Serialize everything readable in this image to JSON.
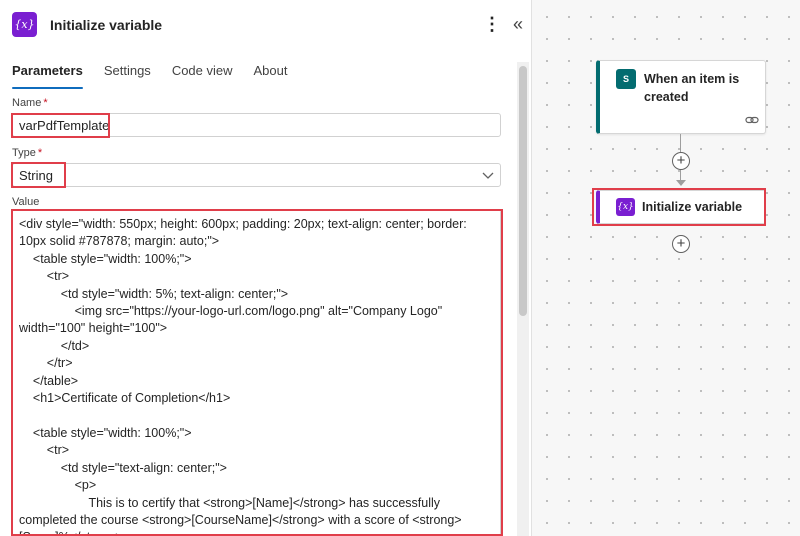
{
  "panel": {
    "title": "Initialize variable",
    "icon_glyph": "{x}",
    "more_glyph": "⋮",
    "collapse_glyph": "«",
    "tabs": [
      {
        "label": "Parameters",
        "active": true
      },
      {
        "label": "Settings",
        "active": false
      },
      {
        "label": "Code view",
        "active": false
      },
      {
        "label": "About",
        "active": false
      }
    ],
    "name_label": "Name",
    "name_value": "varPdfTemplate",
    "type_label": "Type",
    "type_value": "String",
    "value_label": "Value",
    "required_mark": "*",
    "value_code": "<div style=\"width: 550px; height: 600px; padding: 20px; text-align: center; border: 10px solid #787878; margin: auto;\">\n    <table style=\"width: 100%;\">\n        <tr>\n            <td style=\"width: 5%; text-align: center;\">\n                <img src=\"https://your-logo-url.com/logo.png\" alt=\"Company Logo\" width=\"100\" height=\"100\">\n            </td>\n        </tr>\n    </table>\n    <h1>Certificate of Completion</h1>\n\n    <table style=\"width: 100%;\">\n        <tr>\n            <td style=\"text-align: center;\">\n                <p>\n                    This is to certify that <strong>[Name]</strong> has successfully completed the course <strong>[CourseName]</strong> with a score of <strong>[Score]%</strong>."
  },
  "canvas": {
    "trigger": {
      "title": "When an item is created",
      "icon": "sharepoint-icon",
      "icon_text": "S"
    },
    "action": {
      "title": "Initialize variable",
      "icon_glyph": "{x}"
    },
    "plus_glyph": "+"
  },
  "colors": {
    "variable_purple": "#7a1fd1",
    "sharepoint_teal": "#036c70",
    "highlight_red": "#e03e4a",
    "tab_underline": "#0f6cbd"
  }
}
